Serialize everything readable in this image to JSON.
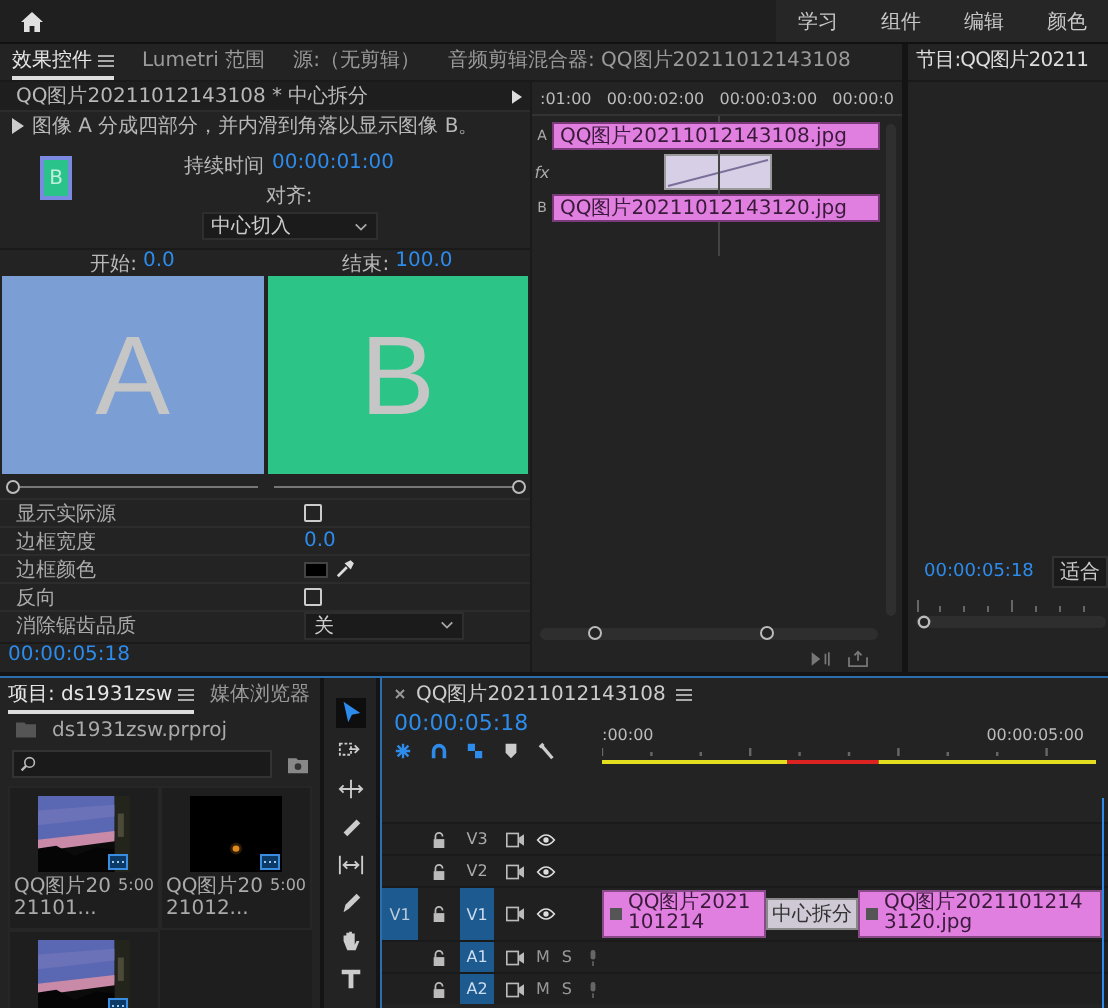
{
  "top_bar": {
    "workspaces": [
      "学习",
      "组件",
      "编辑",
      "颜色"
    ]
  },
  "panel_tabs": [
    {
      "label": "效果控件",
      "selected": true,
      "menu": true
    },
    {
      "label": "Lumetri 范围",
      "selected": false,
      "menu": false
    },
    {
      "label": "源:（无剪辑）",
      "selected": false,
      "menu": false
    },
    {
      "label": "音频剪辑混合器: QQ图片20211012143108",
      "selected": false,
      "menu": false
    }
  ],
  "effect_controls": {
    "clip_effect": "QQ图片20211012143108 * 中心拆分",
    "description": "图像 A 分成四部分，并内滑到角落以显示图像 B。",
    "thumbnail_letter": "B",
    "duration_label": "持续时间",
    "duration": "00:00:01:00",
    "alignment_label": "对齐:",
    "alignment": "中心切入",
    "start_label": "开始:",
    "start": "0.0",
    "end_label": "结束:",
    "end": "100.0",
    "preview_a": "A",
    "preview_b": "B",
    "start_slider": {
      "level": 0
    },
    "end_slider": {
      "level": 1
    },
    "properties": [
      {
        "kind": "checkbox",
        "label": "显示实际源",
        "checked": false
      },
      {
        "kind": "number",
        "label": "边框宽度",
        "value": "0.0"
      },
      {
        "kind": "color",
        "label": "边框颜色",
        "color": "#000000"
      },
      {
        "kind": "checkbox",
        "label": "反向",
        "checked": false
      },
      {
        "kind": "dropdown",
        "label": "消除锯齿品质",
        "value": "关"
      }
    ],
    "timecode": "00:00:05:18"
  },
  "mini_timeline": {
    "ruler": [
      ":01:00",
      "00:00:02:00",
      "00:00:03:00",
      "00:00:0"
    ],
    "track_a": "A",
    "track_fx": "fx",
    "track_b": "B",
    "clip_a": "QQ图片20211012143108.jpg",
    "clip_b": "QQ图片20211012143120.jpg"
  },
  "program_monitor": {
    "title": "节目:QQ图片20211",
    "timecode": "00:00:05:18",
    "zoom": "适合"
  },
  "project": {
    "tabs": [
      {
        "label": "项目: ds1931zsw",
        "selected": true,
        "menu": true
      },
      {
        "label": "媒体浏览器",
        "selected": false,
        "menu": false
      }
    ],
    "path": "ds1931zsw.prproj",
    "items": [
      {
        "kind": "picture",
        "name": "QQ图片2021101...",
        "duration": "5:00"
      },
      {
        "kind": "picture",
        "name": "QQ图片2021012...",
        "duration": "5:00"
      },
      {
        "kind": "picture"
      }
    ]
  },
  "tools": [
    {
      "selected": true
    },
    {
      "selected": false
    },
    {
      "selected": false
    },
    {
      "selected": false
    },
    {
      "selected": false
    },
    {
      "selected": false
    },
    {
      "selected": false
    },
    {
      "selected": false
    }
  ],
  "sequence": {
    "title": "QQ图片20211012143108",
    "timecode": "00:00:05:18",
    "ruler": [
      ":00:00",
      "00:00:05:00"
    ],
    "tracks": [
      {
        "name": "V3",
        "kind": "video",
        "targeted": false
      },
      {
        "name": "V2",
        "kind": "video",
        "targeted": false
      },
      {
        "name": "V1",
        "kind": "video",
        "targeted": true,
        "source_patch": "V1"
      },
      {
        "name": "A1",
        "kind": "audio",
        "targeted": true,
        "mute": "M",
        "solo": "S"
      },
      {
        "name": "A2",
        "kind": "audio",
        "targeted": true,
        "mute": "M",
        "solo": "S"
      }
    ],
    "clips": [
      {
        "kind": "clip",
        "name": "QQ图片2021101214"
      },
      {
        "kind": "transition",
        "name": "中心拆分"
      },
      {
        "kind": "clip",
        "name": "QQ图片20211012143120.jpg"
      }
    ]
  }
}
